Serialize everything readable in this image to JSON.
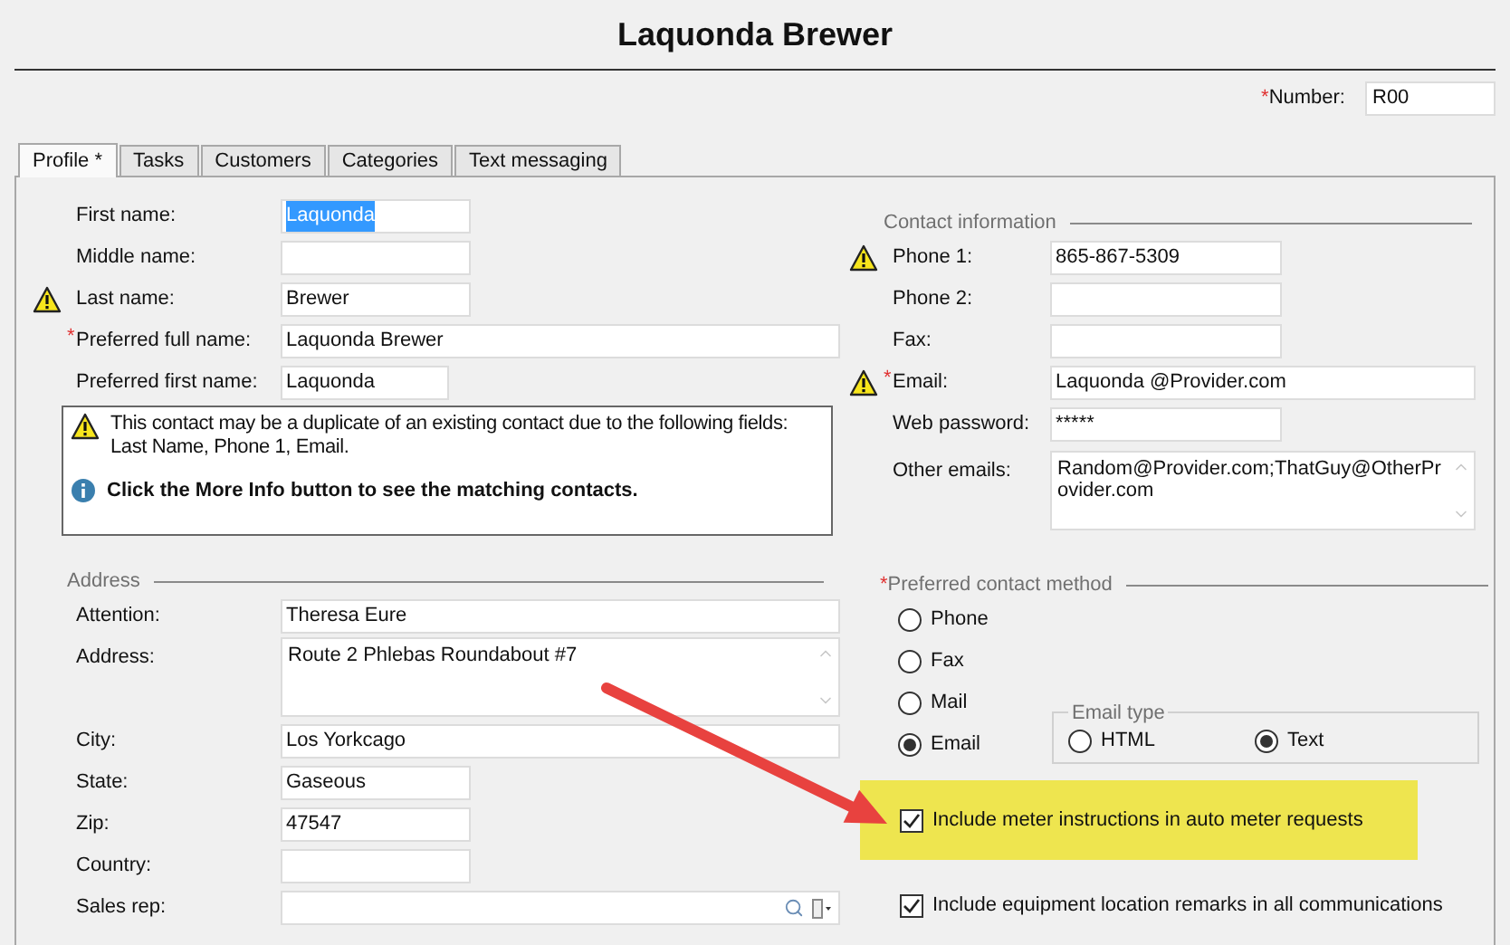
{
  "title": "Laquonda Brewer",
  "number": {
    "required_mark": "*",
    "label": "Number:",
    "value": "R00"
  },
  "tabs": [
    {
      "label": "Profile *",
      "selected": true
    },
    {
      "label": "Tasks",
      "selected": false
    },
    {
      "label": "Customers",
      "selected": false
    },
    {
      "label": "Categories",
      "selected": false
    },
    {
      "label": "Text messaging",
      "selected": false
    }
  ],
  "name_fields": [
    {
      "label": "First name:",
      "value": "Laquonda",
      "kind": "short",
      "warning": false,
      "highlighted": true
    },
    {
      "label": "Middle name:",
      "kind": "short",
      "warning": false
    },
    {
      "label": "Last name:",
      "value": "Brewer",
      "kind": "short",
      "warning": true
    },
    {
      "required_mark": "*",
      "label": "Preferred full name:",
      "value": "Laquonda Brewer",
      "kind": "long",
      "warning": false
    },
    {
      "label": "Preferred first name:",
      "value": "Laquonda",
      "kind": "medium",
      "warning": false
    }
  ],
  "duplicate_notice": {
    "message": "This contact may be a duplicate of an existing contact due to the following fields:\nLast Name, Phone 1, Email.",
    "hint": "Click the More Info button to see the matching contacts."
  },
  "address": {
    "heading": "Address",
    "fields": [
      {
        "label": "Attention:",
        "value": "Theresa Eure",
        "kind": "long"
      },
      {
        "label": "Address:",
        "value": "Route 2 Phlebas Roundabout #7",
        "kind": "textarea"
      },
      {
        "label": "City:",
        "value": "Los Yorkcago",
        "kind": "long"
      },
      {
        "label": "State:",
        "value": "Gaseous",
        "kind": "short"
      },
      {
        "label": "Zip:",
        "value": "47547",
        "kind": "short"
      },
      {
        "label": "Country:",
        "kind": "short"
      },
      {
        "label": "Sales rep:",
        "kind": "lookup"
      }
    ]
  },
  "contact": {
    "heading": "Contact information",
    "fields": [
      {
        "label": "Phone 1:",
        "value": "865-867-5309",
        "kind": "short",
        "warning": true
      },
      {
        "label": "Phone 2:",
        "kind": "short",
        "warning": false
      },
      {
        "label": "Fax:",
        "kind": "short",
        "warning": false
      },
      {
        "required_mark": "*",
        "label": "Email:",
        "value": "Laquonda @Provider.com",
        "kind": "long",
        "warning": true
      },
      {
        "label": "Web password:",
        "value": "*****",
        "kind": "short",
        "warning": false
      },
      {
        "label": "Other emails:",
        "value": "Random@Provider.com;ThatGuy@OtherPr\novider.com",
        "kind": "textarea",
        "warning": false
      }
    ]
  },
  "preferred_contact": {
    "required_mark": "*",
    "heading": "Preferred contact method",
    "options": [
      {
        "label": "Phone",
        "selected": false
      },
      {
        "label": "Fax",
        "selected": false
      },
      {
        "label": "Mail",
        "selected": false
      },
      {
        "label": "Email",
        "selected": true
      }
    ]
  },
  "email_type": {
    "heading": "Email type",
    "options": [
      {
        "label": "HTML",
        "selected": false
      },
      {
        "label": "Text",
        "selected": true
      }
    ]
  },
  "checkboxes": [
    {
      "label": "Include meter instructions in auto meter requests",
      "checked": true,
      "highlighted": true
    },
    {
      "label": "Include equipment location remarks in all communications",
      "checked": true,
      "highlighted": false
    }
  ]
}
